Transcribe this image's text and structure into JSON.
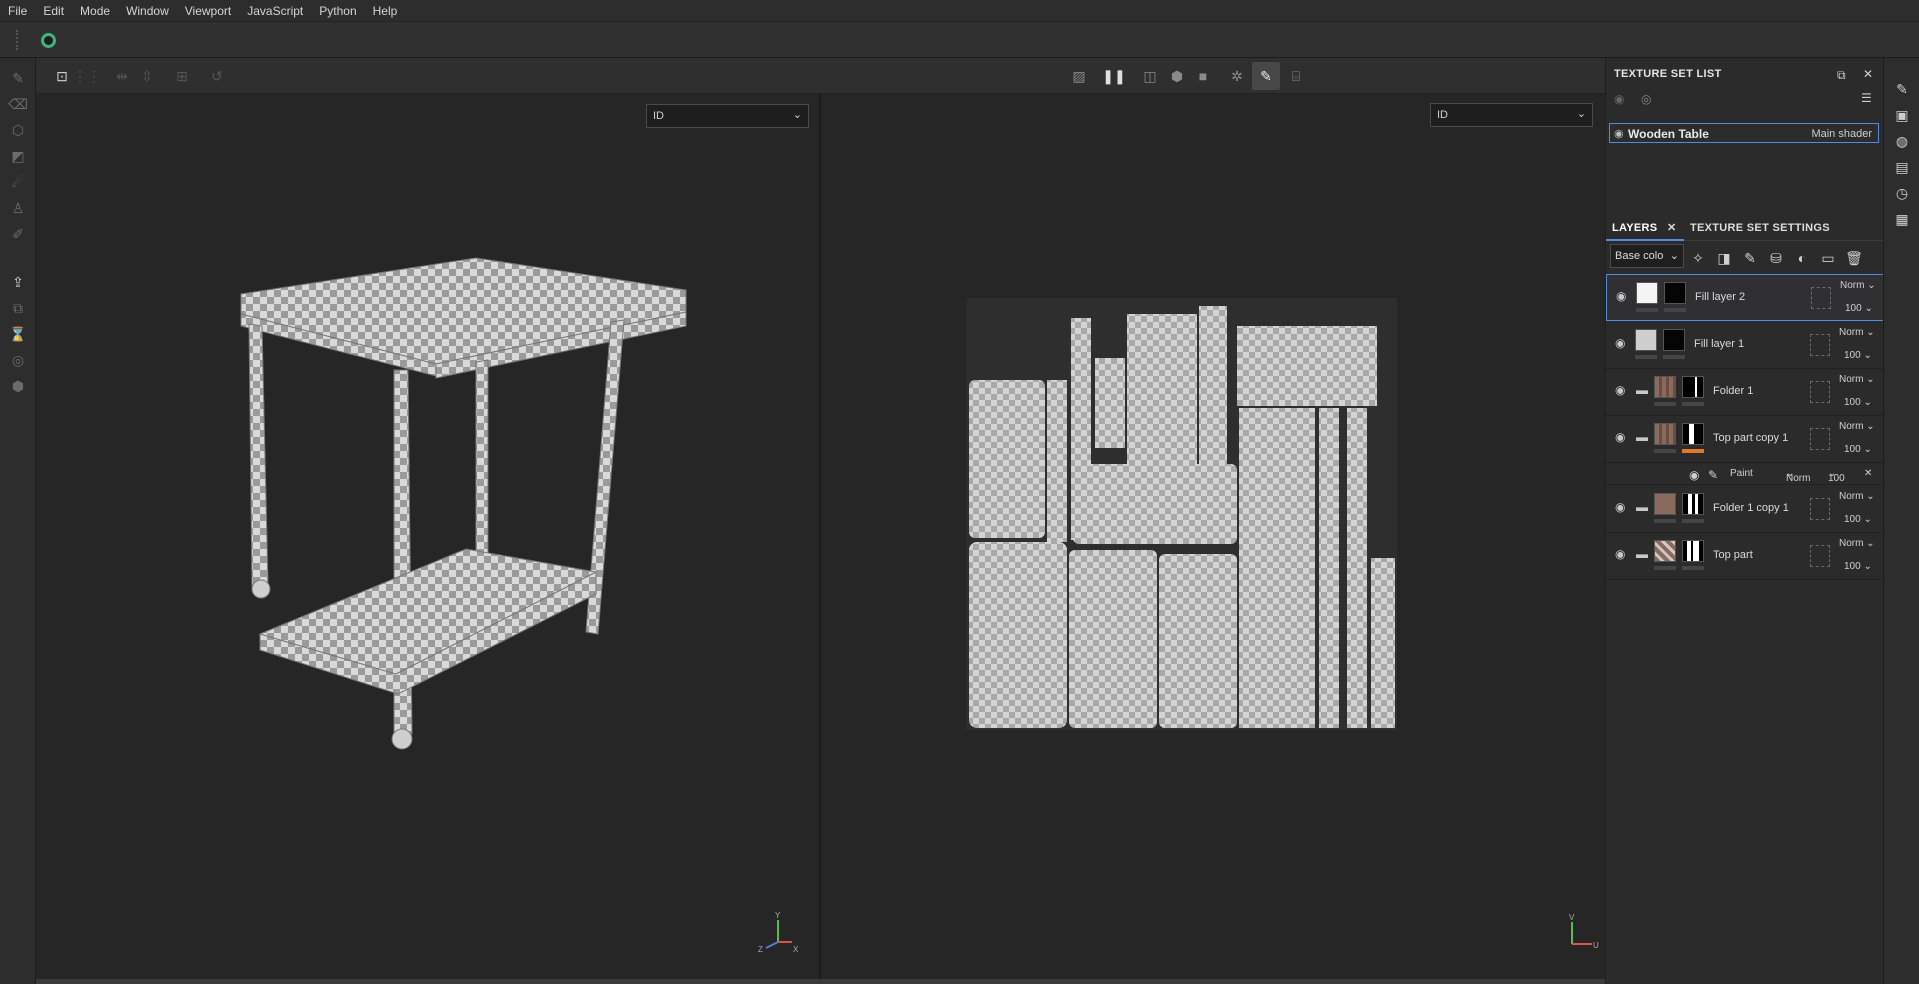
{
  "menu": [
    "File",
    "Edit",
    "Mode",
    "Window",
    "Viewport",
    "JavaScript",
    "Python",
    "Help"
  ],
  "viewport3d": {
    "channel": "ID"
  },
  "viewport2d": {
    "channel": "ID"
  },
  "axes3d": {
    "y": "Y",
    "z": "Z",
    "x": "X"
  },
  "axes2d": {
    "v": "V",
    "u": "U"
  },
  "texture_set_list": {
    "title": "TEXTURE SET LIST",
    "item": {
      "name": "Wooden Table",
      "shader": "Main shader"
    }
  },
  "layers_panel": {
    "tab_layers": "LAYERS",
    "tab_settings": "TEXTURE SET SETTINGS",
    "channel": "Base colo",
    "layers": [
      {
        "name": "Fill layer 2",
        "blend": "Norm",
        "opacity": "100",
        "folder": false
      },
      {
        "name": "Fill layer 1",
        "blend": "Norm",
        "opacity": "100",
        "folder": false
      },
      {
        "name": "Folder 1",
        "blend": "Norm",
        "opacity": "100",
        "folder": true
      },
      {
        "name": "Top part copy 1",
        "blend": "Norm",
        "opacity": "100",
        "folder": true
      },
      {
        "name": "Folder 1 copy 1",
        "blend": "Norm",
        "opacity": "100",
        "folder": true
      },
      {
        "name": "Top part",
        "blend": "Norm",
        "opacity": "100",
        "folder": true
      }
    ],
    "effect": {
      "name": "Paint",
      "blend": "Norm",
      "opacity": "100"
    }
  },
  "colors": {
    "accent": "#4f8dd8",
    "logo": "#3fb37f",
    "effect_bar": "#e07a2a",
    "wood": "#8a6a5c"
  }
}
